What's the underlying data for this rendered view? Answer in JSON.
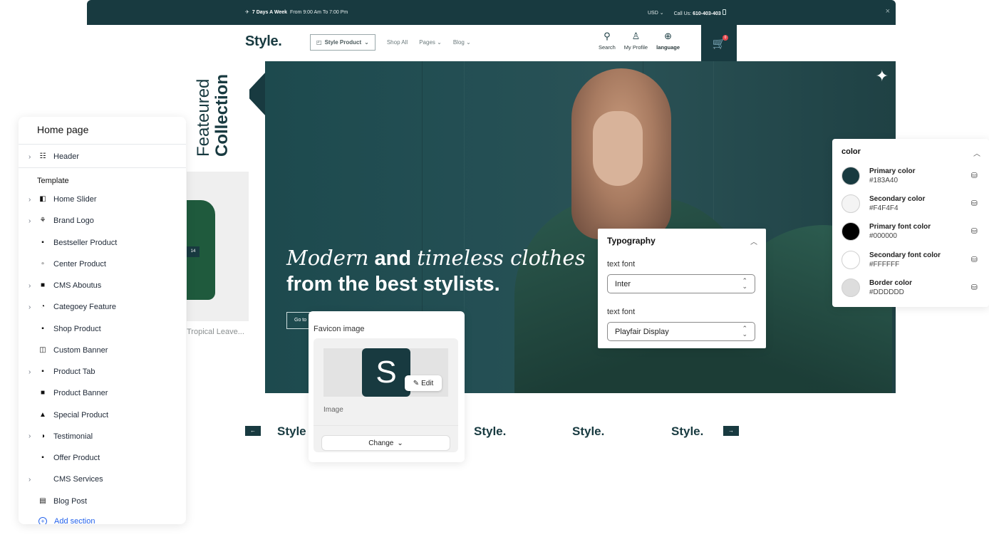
{
  "store": {
    "topbar": {
      "promo_bold": "7 Days A Week",
      "promo_text": "From 9:00 Am To 7:00 Pm",
      "currency": "USD",
      "call_label": "Call Us:",
      "call_number": "610-403-403",
      "close_glyph": "×"
    },
    "logo": "Style.",
    "nav": {
      "pill_label": "Style Product",
      "items": [
        "Shop All",
        "Pages",
        "Blog"
      ]
    },
    "icons": [
      {
        "label": "Search",
        "icon": "search-icon"
      },
      {
        "label": "My Profile",
        "icon": "user-icon"
      },
      {
        "label": "language",
        "icon": "globe-icon"
      }
    ],
    "cart_count": "0",
    "featured": {
      "line1": "Feateured",
      "line2": "Collection"
    },
    "product": {
      "name": "Tropical Leave...",
      "tag": "14"
    },
    "hero": {
      "italic1": "Modern",
      "bold1": "and",
      "italic2": "timeless clothes",
      "line2": "from the best stylists.",
      "button": "Go to"
    },
    "brands": [
      "Style",
      "Style.",
      "Style.",
      "Style."
    ]
  },
  "sidebar": {
    "title": "Home page",
    "header_item": "Header",
    "template_label": "Template",
    "items": [
      {
        "label": "Home Slider",
        "chevron": true
      },
      {
        "label": "Brand Logo",
        "chevron": true
      },
      {
        "label": "Bestseller Product",
        "chevron": false
      },
      {
        "label": "Center Product",
        "chevron": false
      },
      {
        "label": "CMS Aboutus",
        "chevron": true
      },
      {
        "label": "Categoey Feature",
        "chevron": true
      },
      {
        "label": "Shop Product",
        "chevron": false
      },
      {
        "label": "Custom Banner",
        "chevron": false
      },
      {
        "label": "Product Tab",
        "chevron": true
      },
      {
        "label": "Product Banner",
        "chevron": false
      },
      {
        "label": "Special Product",
        "chevron": false
      },
      {
        "label": "Testimonial",
        "chevron": true
      },
      {
        "label": "Offer Product",
        "chevron": false
      },
      {
        "label": "CMS Services",
        "chevron": true
      },
      {
        "label": "Blog Post",
        "chevron": false
      }
    ],
    "add_section": "Add section"
  },
  "favicon": {
    "title": "Favicon image",
    "letter": "S",
    "edit_label": "Edit",
    "image_label": "Image",
    "change_label": "Change"
  },
  "typography": {
    "title": "Typography",
    "fields": [
      {
        "label": "text font",
        "value": "Inter"
      },
      {
        "label": "text font",
        "value": "Playfair Display"
      }
    ]
  },
  "colors": {
    "title": "color",
    "items": [
      {
        "name": "Primary color",
        "hex": "#183A40"
      },
      {
        "name": "Secondary color",
        "hex": "#F4F4F4"
      },
      {
        "name": "Primary font color",
        "hex": "#000000"
      },
      {
        "name": "Secondary font color",
        "hex": "#FFFFFF"
      },
      {
        "name": "Border color",
        "hex": "#DDDDDD"
      }
    ]
  }
}
